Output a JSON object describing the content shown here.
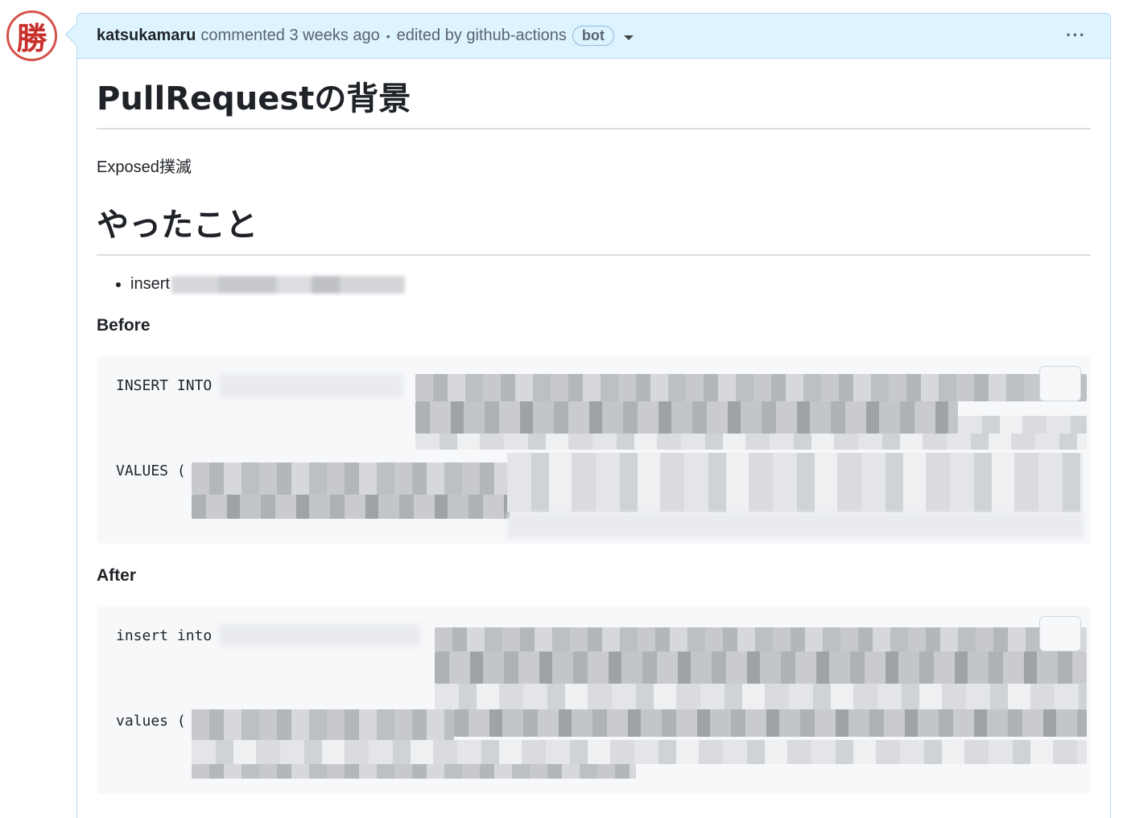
{
  "avatar": {
    "glyph": "勝"
  },
  "header": {
    "author": "katsukamaru",
    "action": "commented 3 weeks ago",
    "separator": "•",
    "edited": "edited by github-actions",
    "badge": "bot",
    "menu": "···"
  },
  "body": {
    "h1_background": "PullRequestの背景",
    "paragraph": "Exposed撲滅",
    "h1_done": "やったこと",
    "list_items": [
      {
        "prefix": "insert"
      }
    ],
    "before_heading": "Before",
    "before_code": {
      "line1": "INSERT INTO",
      "line2": "VALUES ("
    },
    "after_heading": "After",
    "after_code": {
      "line1": "insert into",
      "line2": "values ("
    }
  },
  "colors": {
    "header_bg": "#ddf4ff",
    "header_border": "#b6d7f5",
    "code_bg": "#f6f8fa",
    "avatar_red": "#c8302b"
  },
  "icons": [
    "kebab-menu-icon",
    "chevron-down-icon",
    "copy-icon"
  ]
}
